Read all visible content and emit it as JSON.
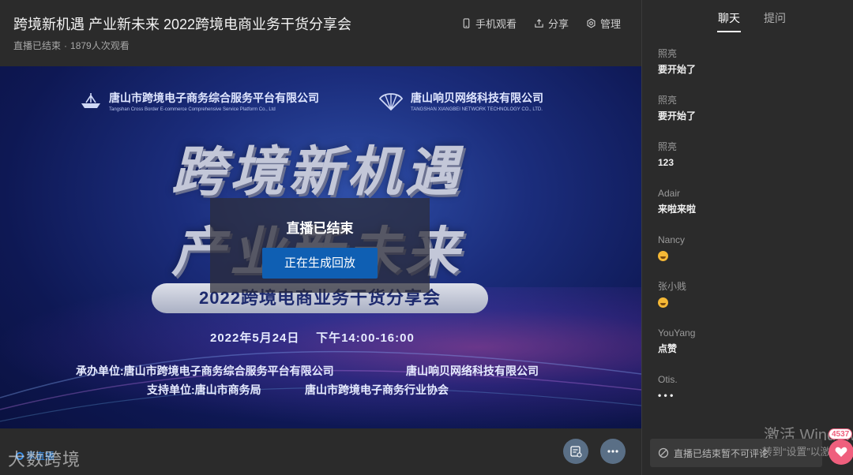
{
  "header": {
    "title": "跨境新机遇 产业新未来 2022跨境电商业务干货分享会",
    "status": "直播已结束",
    "separator": "·",
    "viewers": "1879人次观看",
    "actions": [
      {
        "label": "手机观看",
        "icon": "phone-icon"
      },
      {
        "label": "分享",
        "icon": "share-icon"
      },
      {
        "label": "管理",
        "icon": "gear-icon"
      }
    ]
  },
  "poster": {
    "org1_cn": "唐山市跨境电子商务综合服务平台有限公司",
    "org1_en": "Tangshan Cross Border E-commerce Comprehensive Service Platform Co., Ltd",
    "org2_cn": "唐山响贝网络科技有限公司",
    "org2_en": "TANGSHAN XIANGBEI NETWORK TECHNOLOGY CO., LTD.",
    "headline1": "跨境新机遇",
    "headline2": "产业新未来",
    "event_name": "2022跨境电商业务干货分享会",
    "date": "2022年5月24日",
    "time": "下午14:00-16:00",
    "host_label_1": "承办单位:唐山市跨境电子商务综合服务平台有限公司",
    "host_label_2": "唐山响贝网络科技有限公司",
    "support_label_1": "支持单位:唐山市商务局",
    "support_label_2": "唐山市跨境电子商务行业协会"
  },
  "overlay": {
    "ended_text": "直播已结束",
    "replay_button": "正在生成回放"
  },
  "bottom": {
    "logo_text": "享直播",
    "watermark": "大数跨境"
  },
  "chat": {
    "tabs": [
      "聊天",
      "提问"
    ],
    "messages": [
      {
        "user": "照亮",
        "text": "要开始了"
      },
      {
        "user": "照亮",
        "text": "要开始了"
      },
      {
        "user": "照亮",
        "text": "123"
      },
      {
        "user": "Adair",
        "text": "来啦来啦"
      },
      {
        "user": "Nancy",
        "text": "",
        "emoji": "grin-emoji"
      },
      {
        "user": "张小贱",
        "text": "",
        "emoji": "smile-emoji"
      },
      {
        "user": "YouYang",
        "text": "点赞"
      },
      {
        "user": "Otis.",
        "text": "• • •"
      }
    ],
    "input_placeholder": "直播已结束暂不可评论",
    "like_count": "4537",
    "os_watermark_1": "激活 Windows",
    "os_watermark_2": "转到“设置”以激活 Windows。"
  },
  "colors": {
    "panel_bg": "#2b2b2b",
    "accent_blue": "#0f5fb3",
    "like_pink": "#ef5f7d"
  }
}
